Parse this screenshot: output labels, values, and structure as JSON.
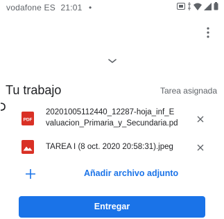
{
  "status_bar": {
    "carrier": "vodafone ES",
    "time": "21:01",
    "dot": "•"
  },
  "icons": {
    "more": "more-vert-icon",
    "chevron": "chevron-down-icon",
    "pdf": "pdf-file-icon",
    "image": "image-file-icon",
    "remove": "close-icon",
    "add": "plus-icon"
  },
  "sheet": {
    "title": "Tu trabajo",
    "status": "Tarea asignada"
  },
  "attachments": [
    {
      "name_line1": "20201005112440_12287-hoja_inf_E",
      "name_line2": "valuacion_Primaria_y_Secundaria.pd",
      "type": "pdf",
      "icon_color": "#d93025"
    },
    {
      "name_line1": "TAREA I (8 oct. 2020 20:58:31).jpeg",
      "type": "image",
      "icon_color": "#d93025"
    }
  ],
  "add_attachment_label": "Añadir archivo adjunto",
  "submit_label": "Entregar",
  "colors": {
    "accent": "#1a73e8",
    "file_icon": "#d93025",
    "text": "#202124",
    "muted": "#5f6368"
  }
}
